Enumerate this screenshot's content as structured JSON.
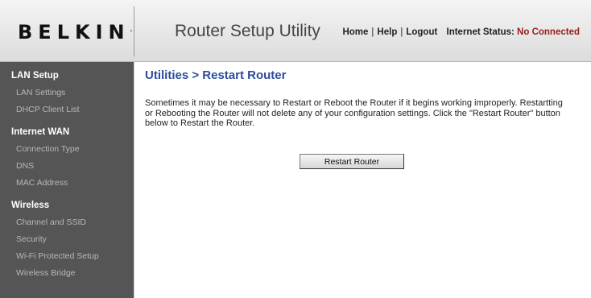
{
  "header": {
    "logo": "BELKIN",
    "logo_mark": ".",
    "app_title": "Router Setup Utility",
    "links": {
      "home": "Home",
      "help": "Help",
      "logout": "Logout",
      "separator": "|"
    },
    "status_label": "Internet Status:",
    "status_value": "No Connected",
    "status_color": "#9b1b1b"
  },
  "sidebar": {
    "sections": [
      {
        "title": "LAN Setup",
        "items": [
          "LAN Settings",
          "DHCP Client List"
        ]
      },
      {
        "title": "Internet WAN",
        "items": [
          "Connection Type",
          "DNS",
          "MAC Address"
        ]
      },
      {
        "title": "Wireless",
        "items": [
          "Channel and SSID",
          "Security",
          "Wi-Fi Protected Setup",
          "Wireless Bridge"
        ]
      }
    ]
  },
  "main": {
    "title": "Utilities > Restart Router",
    "description": "Sometimes it may be necessary to Restart or Reboot the Router if it begins working improperly. Restartting or Rebooting the Router will not delete any of your configuration settings. Click the \"Restart Router\" button below to Restart the Router.",
    "restart_button": "Restart Router"
  },
  "colors": {
    "title_blue": "#2c4ca0",
    "sidebar_bg": "#555555",
    "sidebar_item": "#b8b8b8"
  }
}
